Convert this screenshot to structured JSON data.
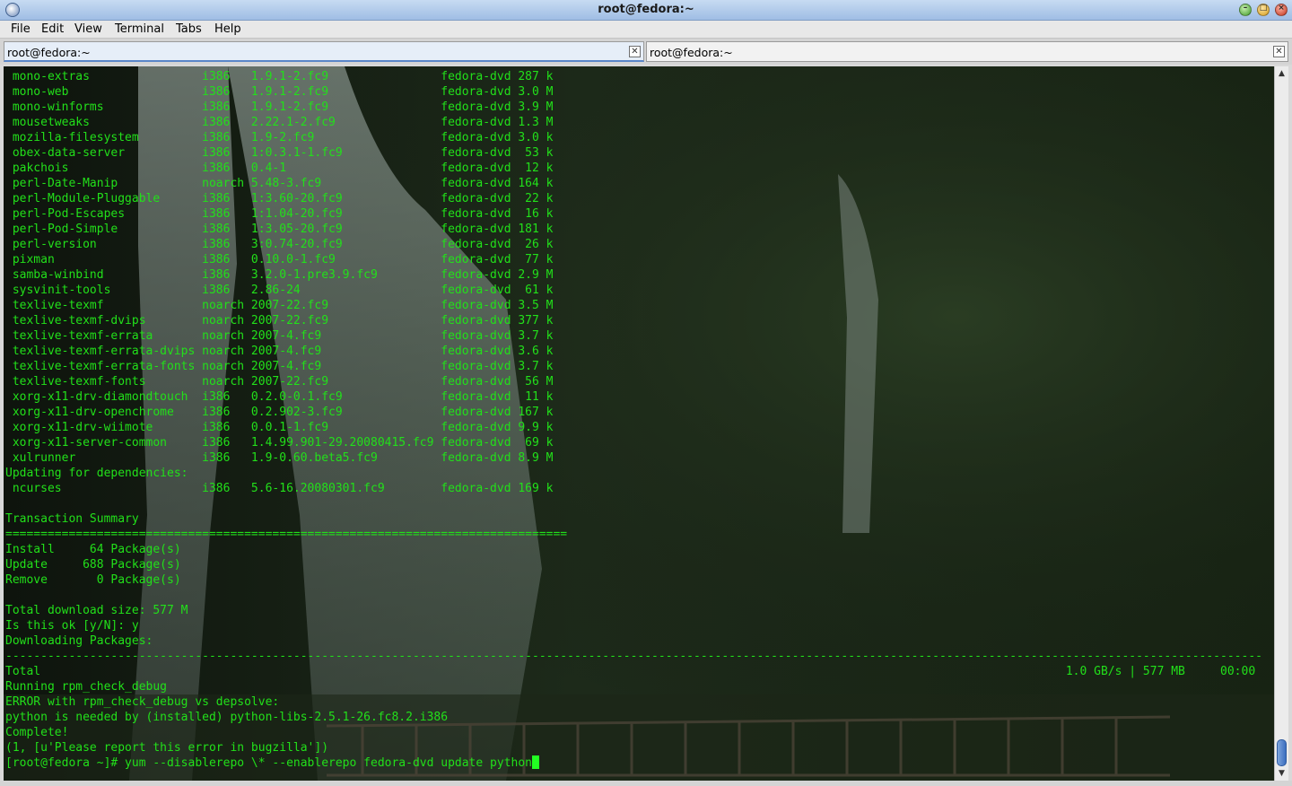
{
  "window": {
    "title": "root@fedora:~"
  },
  "menu": [
    "File",
    "Edit",
    "View",
    "Terminal",
    "Tabs",
    "Help"
  ],
  "tabs": [
    {
      "label": "root@fedora:~",
      "active": true
    },
    {
      "label": "root@fedora:~",
      "active": false
    }
  ],
  "colors": {
    "terminal_text": "#22e01a",
    "cursor": "#22ff22",
    "tab_accent": "#5a86c8"
  },
  "terminal": {
    "lines": [
      " mono-extras                i386   1.9.1-2.fc9                fedora-dvd 287 k",
      " mono-web                   i386   1.9.1-2.fc9                fedora-dvd 3.0 M",
      " mono-winforms              i386   1.9.1-2.fc9                fedora-dvd 3.9 M",
      " mousetweaks                i386   2.22.1-2.fc9               fedora-dvd 1.3 M",
      " mozilla-filesystem         i386   1.9-2.fc9                  fedora-dvd 3.0 k",
      " obex-data-server           i386   1:0.3.1-1.fc9              fedora-dvd  53 k",
      " pakchois                   i386   0.4-1                      fedora-dvd  12 k",
      " perl-Date-Manip            noarch 5.48-3.fc9                 fedora-dvd 164 k",
      " perl-Module-Pluggable      i386   1:3.60-20.fc9              fedora-dvd  22 k",
      " perl-Pod-Escapes           i386   1:1.04-20.fc9              fedora-dvd  16 k",
      " perl-Pod-Simple            i386   1:3.05-20.fc9              fedora-dvd 181 k",
      " perl-version               i386   3:0.74-20.fc9              fedora-dvd  26 k",
      " pixman                     i386   0.10.0-1.fc9               fedora-dvd  77 k",
      " samba-winbind              i386   3.2.0-1.pre3.9.fc9         fedora-dvd 2.9 M",
      " sysvinit-tools             i386   2.86-24                    fedora-dvd  61 k",
      " texlive-texmf              noarch 2007-22.fc9                fedora-dvd 3.5 M",
      " texlive-texmf-dvips        noarch 2007-22.fc9                fedora-dvd 377 k",
      " texlive-texmf-errata       noarch 2007-4.fc9                 fedora-dvd 3.7 k",
      " texlive-texmf-errata-dvips noarch 2007-4.fc9                 fedora-dvd 3.6 k",
      " texlive-texmf-errata-fonts noarch 2007-4.fc9                 fedora-dvd 3.7 k",
      " texlive-texmf-fonts        noarch 2007-22.fc9                fedora-dvd  56 M",
      " xorg-x11-drv-diamondtouch  i386   0.2.0-0.1.fc9              fedora-dvd  11 k",
      " xorg-x11-drv-openchrome    i386   0.2.902-3.fc9              fedora-dvd 167 k",
      " xorg-x11-drv-wiimote       i386   0.0.1-1.fc9                fedora-dvd 9.9 k",
      " xorg-x11-server-common     i386   1.4.99.901-29.20080415.fc9 fedora-dvd  69 k",
      " xulrunner                  i386   1.9-0.60.beta5.fc9         fedora-dvd 8.9 M",
      "Updating for dependencies:",
      " ncurses                    i386   5.6-16.20080301.fc9        fedora-dvd 169 k",
      "",
      "Transaction Summary",
      "================================================================================",
      "Install     64 Package(s)",
      "Update     688 Package(s)",
      "Remove       0 Package(s)",
      "",
      "Total download size: 577 M",
      "Is this ok [y/N]: y",
      "Downloading Packages:",
      "-----------------------------------------------------------------------------------------------------------------------------------------------------------------------------------",
      "Total                                                                                                                                                  1.0 GB/s | 577 MB     00:00",
      "Running rpm_check_debug",
      "ERROR with rpm_check_debug vs depsolve:",
      "python is needed by (installed) python-libs-2.5.1-26.fc8.2.i386",
      "Complete!",
      "(1, [u'Please report this error in bugzilla'])",
      "[root@fedora ~]# yum --disablerepo \\* --enablerepo fedora-dvd update python"
    ]
  }
}
